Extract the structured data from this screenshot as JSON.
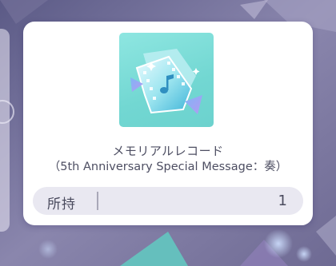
{
  "item": {
    "name": "メモリアルレコード",
    "subtitle": "（5th Anniversary Special Message：奏）",
    "icon": "film-reel-music-icon"
  },
  "owned": {
    "label": "所持",
    "count": "1"
  },
  "colors": {
    "icon_background": "#78dcd7",
    "card_background": "#ffffff",
    "owned_bar": "#e9e8f1",
    "text": "#4d4e62"
  }
}
